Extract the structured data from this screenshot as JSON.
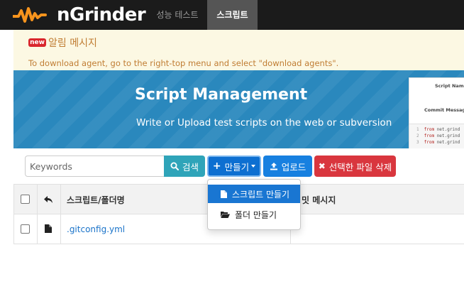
{
  "app": {
    "logo_text": "nGrinder",
    "brand_color": "#f7941d"
  },
  "nav": {
    "items": [
      {
        "label": "성능 테스트",
        "active": false
      },
      {
        "label": "스크립트",
        "active": true
      }
    ]
  },
  "notice": {
    "badge": "new",
    "title": "알림 메시지",
    "text": "To download agent, go to the right-top menu and select \"download agents\"."
  },
  "banner": {
    "title": "Script Management",
    "subtitle": "Write or Upload test scripts on the web or subversion",
    "card": {
      "script_name_label": "Script Name",
      "commit_label": "Commit Message",
      "code_lines": [
        {
          "num": "1",
          "kw": "from",
          "rest": " net.grind"
        },
        {
          "num": "2",
          "kw": "from",
          "rest": " net.grind"
        },
        {
          "num": "3",
          "kw": "from",
          "rest": " net.grind"
        }
      ]
    }
  },
  "toolbar": {
    "search_placeholder": "Keywords",
    "search_label": "검색",
    "make_label": "만들기",
    "upload_label": "업로드",
    "delete_label": "선택한 파일 삭제"
  },
  "dropdown": {
    "items": [
      {
        "label": "스크립트 만들기",
        "icon": "file-icon",
        "active": true
      },
      {
        "label": "폴더 만들기",
        "icon": "folder-open-icon",
        "active": false
      }
    ]
  },
  "table": {
    "columns": [
      "스크립트/폴더명",
      "커밋 메시지"
    ],
    "rows": [
      {
        "name": ".gitconfig.yml",
        "commit": ""
      }
    ]
  }
}
